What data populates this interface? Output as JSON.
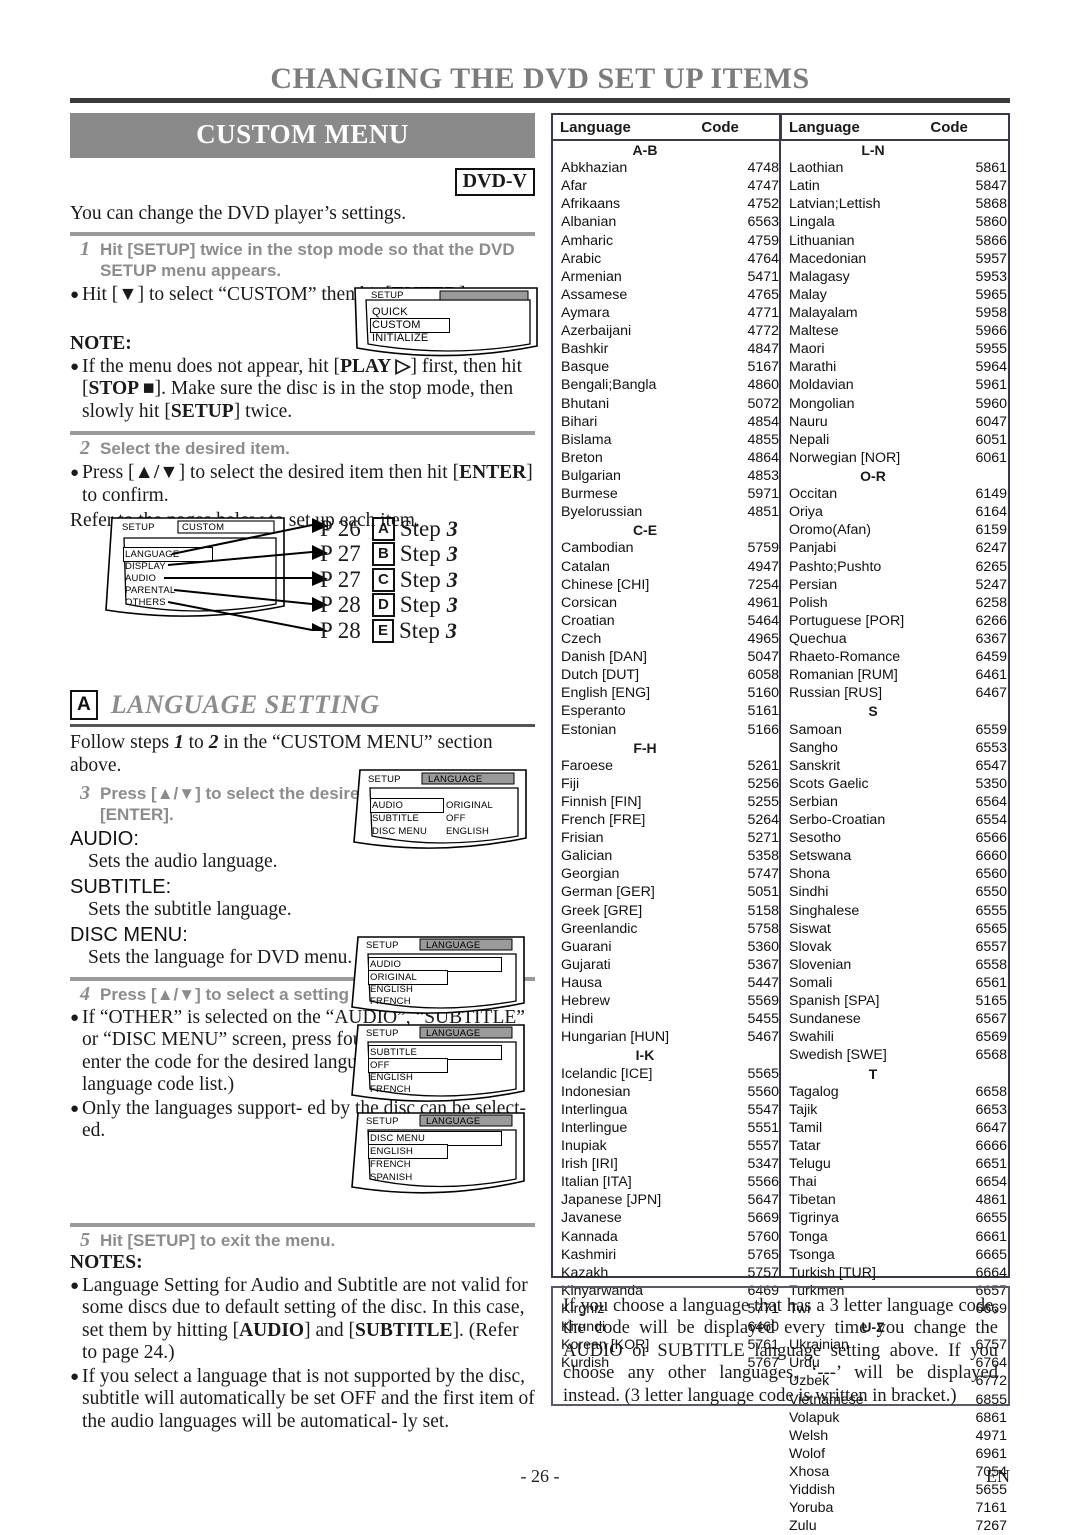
{
  "header": {
    "title": "CHANGING THE DVD SET UP ITEMS"
  },
  "left": {
    "section_banner": "CUSTOM MENU",
    "disc_badge": "DVD-V",
    "intro": "You can change the DVD player’s settings.",
    "step1": {
      "num": "1",
      "text": "Hit [SETUP] twice in the stop mode so that the DVD SETUP menu appears."
    },
    "step1_bullet": {
      "dot": "●",
      "part1": "Hit [",
      "arrow": "▼",
      "part2": "] to select “CUSTOM” then hit [",
      "enter": "ENTER",
      "part3": "]."
    },
    "note_head": "NOTE:",
    "note_bullet": {
      "dot": "●",
      "t1": "If the menu does not appear, hit [",
      "play": "PLAY ▷",
      "t2": "] first, then hit [",
      "stop": "STOP ■",
      "t3": "]. Make sure the disc is in the stop mode, then slowly hit [",
      "setup": "SETUP",
      "t4": "] twice."
    },
    "step2": {
      "num": "2",
      "text": "Select the desired item."
    },
    "step2_bullet": {
      "dot": "●",
      "t1": "Press [",
      "updown": "▲/▼",
      "t2": "] to select the desired item then hit [",
      "enter": "ENTER",
      "t3": "] to confirm."
    },
    "refer_line": "Refer to the pages below to set up each item.",
    "pointers": [
      {
        "page": "P 26",
        "letter": "A",
        "step": "Step",
        "num": "3"
      },
      {
        "page": "P 27",
        "letter": "B",
        "step": "Step",
        "num": "3"
      },
      {
        "page": "P 27",
        "letter": "C",
        "step": "Step",
        "num": "3"
      },
      {
        "page": "P 28",
        "letter": "D",
        "step": "Step",
        "num": "3"
      },
      {
        "page": "P 28",
        "letter": "E",
        "step": "Step",
        "num": "3"
      }
    ],
    "section_a": {
      "letter": "A",
      "title": "LANGUAGE SETTING",
      "follow": {
        "t1": "Follow steps ",
        "n1": "1",
        "t2": " to ",
        "n2": "2",
        "t3": " in the “CUSTOM MENU” section above."
      },
      "step3": {
        "num": "3",
        "text": "Press [▲/▼] to select the desired item then hit [ENTER]."
      },
      "audio_label": "AUDIO:",
      "audio_desc": "Sets the audio language.",
      "subtitle_label": "SUBTITLE:",
      "subtitle_desc": "Sets the subtitle language.",
      "discmenu_label": "DISC MENU:",
      "discmenu_desc": "Sets the language for DVD menu.",
      "step4": {
        "num": "4",
        "text": "Press [▲/▼] to select a setting then hit [ENTER]."
      },
      "bullet4": {
        "dot": "●",
        "text": "If “OTHER” is selected on the “AUDIO”, “SUBTITLE” or “DISC MENU” screen, press four-digit number to enter the code for the desired language. (Refer to the language code list.)"
      },
      "bullet5": {
        "dot": "●",
        "text": "Only the languages support- ed by the disc can be select- ed."
      },
      "step5": {
        "num": "5",
        "text": "Hit [SETUP] to exit the menu."
      },
      "notes_head": "NOTES:",
      "note1": {
        "dot": "●",
        "t1": "Language Setting for Audio and Subtitle are not valid for some discs due to default setting of the disc. In this case, set them by hitting [",
        "audio": "AUDIO",
        "t2": "] and [",
        "subtitle": "SUBTITLE",
        "t3": "]. (Refer to page 24.)"
      },
      "note2": {
        "dot": "●",
        "text": "If you select a language that is not supported by the disc, subtitle will automatically be set OFF and the first item of the audio languages will be automatical- ly set."
      }
    }
  },
  "osd": {
    "setup_custom": {
      "title": "SETUP",
      "items": [
        "QUICK",
        "CUSTOM",
        "INITIALIZE"
      ],
      "selected": "CUSTOM"
    },
    "setup_menu": {
      "title": "SETUP",
      "tab": "CUSTOM",
      "items": [
        "LANGUAGE",
        "DISPLAY",
        "AUDIO",
        "PARENTAL",
        "OTHERS"
      ],
      "selected": "LANGUAGE"
    },
    "language_overview": {
      "title": "SETUP",
      "tab": "LANGUAGE",
      "rows": [
        {
          "name": "AUDIO",
          "value": "ORIGINAL"
        },
        {
          "name": "SUBTITLE",
          "value": "OFF"
        },
        {
          "name": "DISC MENU",
          "value": "ENGLISH"
        }
      ],
      "selected": "AUDIO"
    },
    "audio_screen": {
      "title": "SETUP",
      "tab": "LANGUAGE",
      "header": "AUDIO",
      "items": [
        "ORIGINAL",
        "ENGLISH",
        "FRENCH"
      ],
      "selected": "ORIGINAL"
    },
    "subtitle_screen": {
      "title": "SETUP",
      "tab": "LANGUAGE",
      "header": "SUBTITLE",
      "items": [
        "OFF",
        "ENGLISH",
        "FRENCH"
      ],
      "selected": "OFF"
    },
    "discmenu_screen": {
      "title": "SETUP",
      "tab": "LANGUAGE",
      "header": "DISC MENU",
      "items": [
        "ENGLISH",
        "FRENCH",
        "SPANISH"
      ],
      "selected": "ENGLISH"
    }
  },
  "lang_table": {
    "headers": {
      "language": "Language",
      "code": "Code"
    },
    "left_column": [
      {
        "group": "A-B"
      },
      {
        "name": "Abkhazian",
        "code": "4748"
      },
      {
        "name": "Afar",
        "code": "4747"
      },
      {
        "name": "Afrikaans",
        "code": "4752"
      },
      {
        "name": "Albanian",
        "code": "6563"
      },
      {
        "name": "Amharic",
        "code": "4759"
      },
      {
        "name": "Arabic",
        "code": "4764"
      },
      {
        "name": "Armenian",
        "code": "5471"
      },
      {
        "name": "Assamese",
        "code": "4765"
      },
      {
        "name": "Aymara",
        "code": "4771"
      },
      {
        "name": "Azerbaijani",
        "code": "4772"
      },
      {
        "name": "Bashkir",
        "code": "4847"
      },
      {
        "name": "Basque",
        "code": "5167"
      },
      {
        "name": "Bengali;Bangla",
        "code": "4860"
      },
      {
        "name": "Bhutani",
        "code": "5072"
      },
      {
        "name": "Bihari",
        "code": "4854"
      },
      {
        "name": "Bislama",
        "code": "4855"
      },
      {
        "name": "Breton",
        "code": "4864"
      },
      {
        "name": "Bulgarian",
        "code": "4853"
      },
      {
        "name": "Burmese",
        "code": "5971"
      },
      {
        "name": "Byelorussian",
        "code": "4851"
      },
      {
        "group": "C-E"
      },
      {
        "name": "Cambodian",
        "code": "5759"
      },
      {
        "name": "Catalan",
        "code": "4947"
      },
      {
        "name": "Chinese [CHI]",
        "code": "7254"
      },
      {
        "name": "Corsican",
        "code": "4961"
      },
      {
        "name": "Croatian",
        "code": "5464"
      },
      {
        "name": "Czech",
        "code": "4965"
      },
      {
        "name": "Danish [DAN]",
        "code": "5047"
      },
      {
        "name": "Dutch [DUT]",
        "code": "6058"
      },
      {
        "name": "English [ENG]",
        "code": "5160"
      },
      {
        "name": "Esperanto",
        "code": "5161"
      },
      {
        "name": "Estonian",
        "code": "5166"
      },
      {
        "group": "F-H"
      },
      {
        "name": "Faroese",
        "code": "5261"
      },
      {
        "name": "Fiji",
        "code": "5256"
      },
      {
        "name": "Finnish [FIN]",
        "code": "5255"
      },
      {
        "name": "French [FRE]",
        "code": "5264"
      },
      {
        "name": "Frisian",
        "code": "5271"
      },
      {
        "name": "Galician",
        "code": "5358"
      },
      {
        "name": "Georgian",
        "code": "5747"
      },
      {
        "name": "German [GER]",
        "code": "5051"
      },
      {
        "name": "Greek [GRE]",
        "code": "5158"
      },
      {
        "name": "Greenlandic",
        "code": "5758"
      },
      {
        "name": "Guarani",
        "code": "5360"
      },
      {
        "name": "Gujarati",
        "code": "5367"
      },
      {
        "name": "Hausa",
        "code": "5447"
      },
      {
        "name": "Hebrew",
        "code": "5569"
      },
      {
        "name": "Hindi",
        "code": "5455"
      },
      {
        "name": "Hungarian [HUN]",
        "code": "5467"
      },
      {
        "group": "I-K"
      },
      {
        "name": "Icelandic [ICE]",
        "code": "5565"
      },
      {
        "name": "Indonesian",
        "code": "5560"
      },
      {
        "name": "Interlingua",
        "code": "5547"
      },
      {
        "name": "Interlingue",
        "code": "5551"
      },
      {
        "name": "Inupiak",
        "code": "5557"
      },
      {
        "name": "Irish [IRI]",
        "code": "5347"
      },
      {
        "name": "Italian [ITA]",
        "code": "5566"
      },
      {
        "name": "Japanese [JPN]",
        "code": "5647"
      },
      {
        "name": "Javanese",
        "code": "5669"
      },
      {
        "name": "Kannada",
        "code": "5760"
      },
      {
        "name": "Kashmiri",
        "code": "5765"
      },
      {
        "name": "Kazakh",
        "code": "5757"
      },
      {
        "name": "Kinyarwanda",
        "code": "6469"
      },
      {
        "name": "Kirghiz",
        "code": "5771"
      },
      {
        "name": "Kirundi",
        "code": "6460"
      },
      {
        "name": "Korean [KOR]",
        "code": "5761"
      },
      {
        "name": "Kurdish",
        "code": "5767"
      }
    ],
    "right_column": [
      {
        "group": "L-N"
      },
      {
        "name": "Laothian",
        "code": "5861"
      },
      {
        "name": "Latin",
        "code": "5847"
      },
      {
        "name": "Latvian;Lettish",
        "code": "5868"
      },
      {
        "name": "Lingala",
        "code": "5860"
      },
      {
        "name": "Lithuanian",
        "code": "5866"
      },
      {
        "name": "Macedonian",
        "code": "5957"
      },
      {
        "name": "Malagasy",
        "code": "5953"
      },
      {
        "name": "Malay",
        "code": "5965"
      },
      {
        "name": "Malayalam",
        "code": "5958"
      },
      {
        "name": "Maltese",
        "code": "5966"
      },
      {
        "name": "Maori",
        "code": "5955"
      },
      {
        "name": "Marathi",
        "code": "5964"
      },
      {
        "name": "Moldavian",
        "code": "5961"
      },
      {
        "name": "Mongolian",
        "code": "5960"
      },
      {
        "name": "Nauru",
        "code": "6047"
      },
      {
        "name": "Nepali",
        "code": "6051"
      },
      {
        "name": "Norwegian [NOR]",
        "code": "6061"
      },
      {
        "group": "O-R"
      },
      {
        "name": "Occitan",
        "code": "6149"
      },
      {
        "name": "Oriya",
        "code": "6164"
      },
      {
        "name": "Oromo(Afan)",
        "code": "6159"
      },
      {
        "name": "Panjabi",
        "code": "6247"
      },
      {
        "name": "Pashto;Pushto",
        "code": "6265"
      },
      {
        "name": "Persian",
        "code": "5247"
      },
      {
        "name": "Polish",
        "code": "6258"
      },
      {
        "name": "Portuguese [POR]",
        "code": "6266"
      },
      {
        "name": "Quechua",
        "code": "6367"
      },
      {
        "name": "Rhaeto-Romance",
        "code": "6459"
      },
      {
        "name": "Romanian [RUM]",
        "code": "6461"
      },
      {
        "name": "Russian [RUS]",
        "code": "6467"
      },
      {
        "group": "S"
      },
      {
        "name": "Samoan",
        "code": "6559"
      },
      {
        "name": "Sangho",
        "code": "6553"
      },
      {
        "name": "Sanskrit",
        "code": "6547"
      },
      {
        "name": "Scots Gaelic",
        "code": "5350"
      },
      {
        "name": "Serbian",
        "code": "6564"
      },
      {
        "name": "Serbo-Croatian",
        "code": "6554"
      },
      {
        "name": "Sesotho",
        "code": "6566"
      },
      {
        "name": "Setswana",
        "code": "6660"
      },
      {
        "name": "Shona",
        "code": "6560"
      },
      {
        "name": "Sindhi",
        "code": "6550"
      },
      {
        "name": "Singhalese",
        "code": "6555"
      },
      {
        "name": "Siswat",
        "code": "6565"
      },
      {
        "name": "Slovak",
        "code": "6557"
      },
      {
        "name": "Slovenian",
        "code": "6558"
      },
      {
        "name": "Somali",
        "code": "6561"
      },
      {
        "name": "Spanish [SPA]",
        "code": "5165"
      },
      {
        "name": "Sundanese",
        "code": "6567"
      },
      {
        "name": "Swahili",
        "code": "6569"
      },
      {
        "name": "Swedish [SWE]",
        "code": "6568"
      },
      {
        "group": "T"
      },
      {
        "name": "Tagalog",
        "code": "6658"
      },
      {
        "name": "Tajik",
        "code": "6653"
      },
      {
        "name": "Tamil",
        "code": "6647"
      },
      {
        "name": "Tatar",
        "code": "6666"
      },
      {
        "name": "Telugu",
        "code": "6651"
      },
      {
        "name": "Thai",
        "code": "6654"
      },
      {
        "name": "Tibetan",
        "code": "4861"
      },
      {
        "name": "Tigrinya",
        "code": "6655"
      },
      {
        "name": "Tonga",
        "code": "6661"
      },
      {
        "name": "Tsonga",
        "code": "6665"
      },
      {
        "name": "Turkish [TUR]",
        "code": "6664"
      },
      {
        "name": "Turkmen",
        "code": "6657"
      },
      {
        "name": "Twi",
        "code": "6669"
      },
      {
        "group": "U-Z"
      },
      {
        "name": "Ukrainian",
        "code": "6757"
      },
      {
        "name": "Urdu",
        "code": "6764"
      },
      {
        "name": "Uzbek",
        "code": "6772"
      },
      {
        "name": "Vietnamese",
        "code": "6855"
      },
      {
        "name": "Volapuk",
        "code": "6861"
      },
      {
        "name": "Welsh",
        "code": "4971"
      },
      {
        "name": "Wolof",
        "code": "6961"
      },
      {
        "name": "Xhosa",
        "code": "7054"
      },
      {
        "name": "Yiddish",
        "code": "5655"
      },
      {
        "name": "Yoruba",
        "code": "7161"
      },
      {
        "name": "Zulu",
        "code": "7267"
      }
    ]
  },
  "bottom_note": "If you choose a language that has a 3 letter language code, the code will be displayed every time you change the AUDIO or SUBTITLE language setting above. If you choose any other languages, ‘---’ will be displayed instead. (3 letter language code is written in bracket.)",
  "footer": {
    "page": "- 26 -",
    "lang": "EN"
  }
}
